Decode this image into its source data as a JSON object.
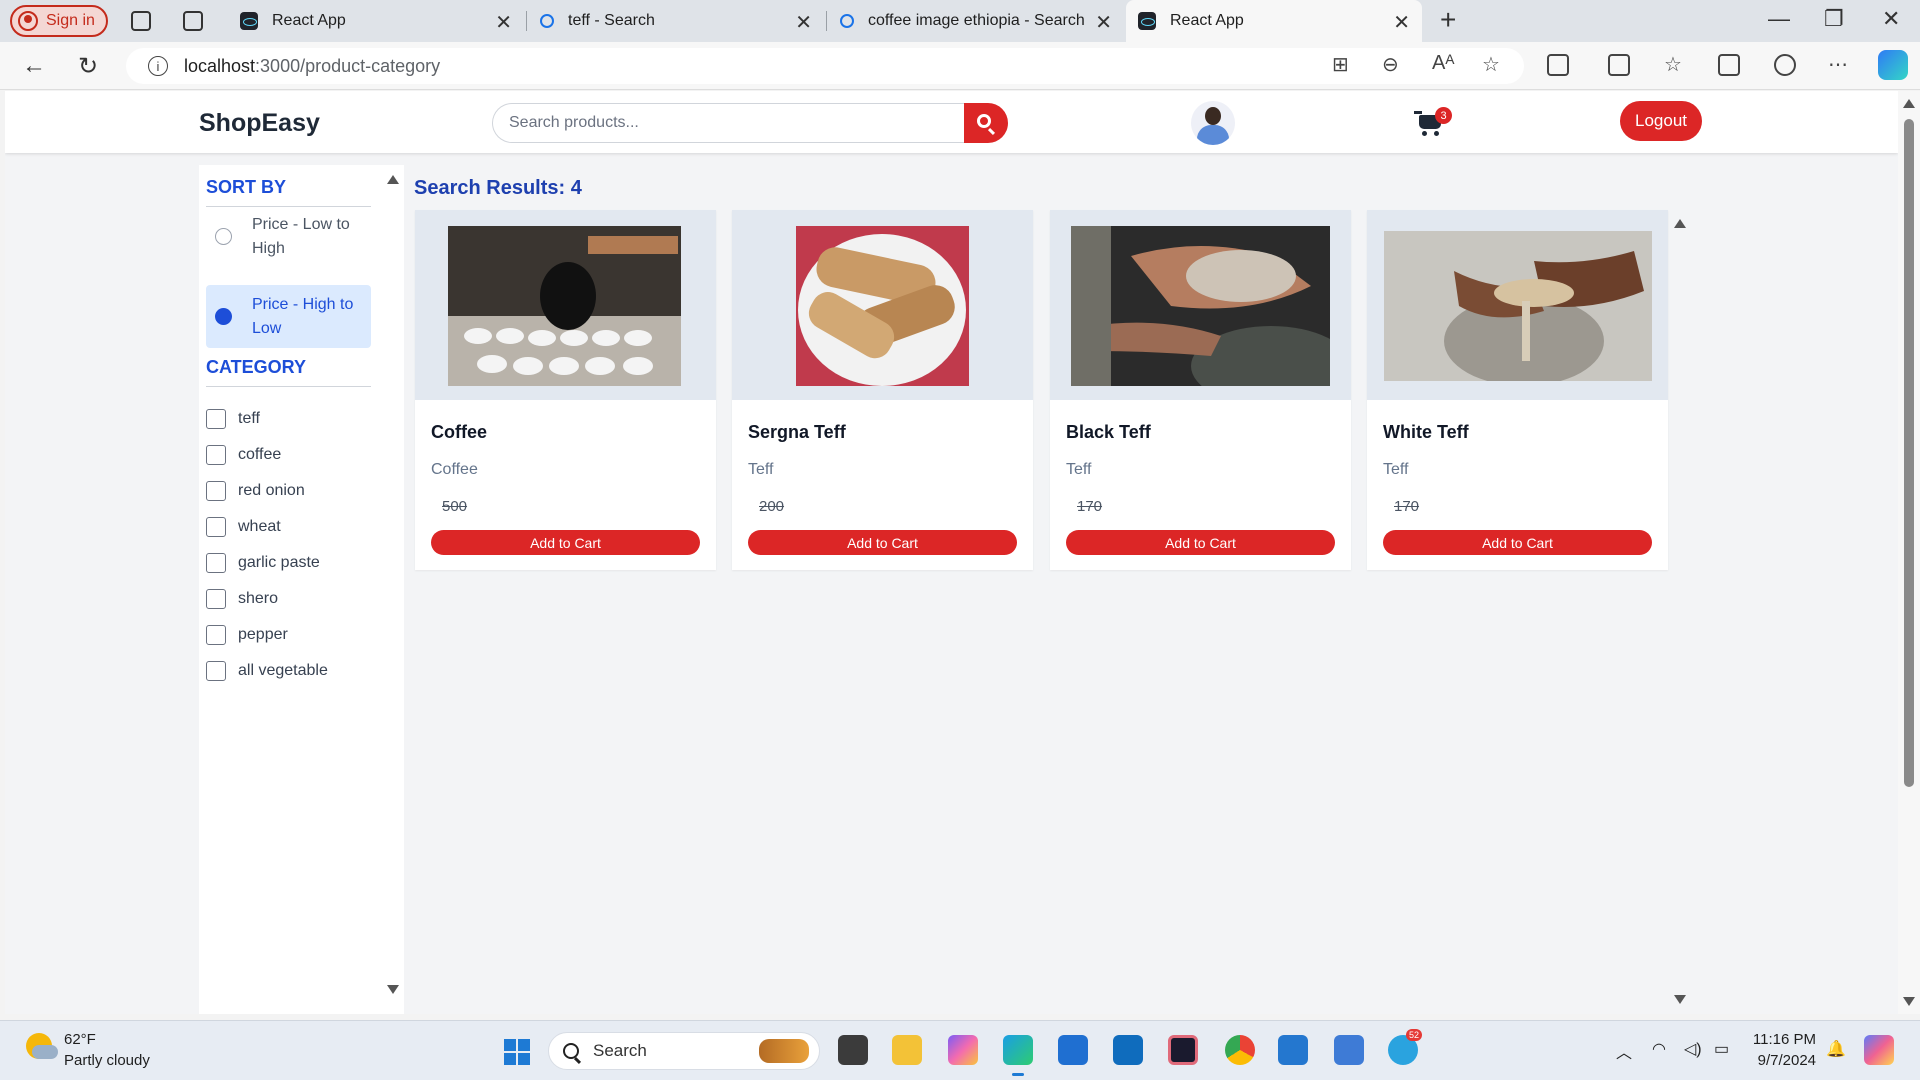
{
  "browser": {
    "sign_in": "Sign in",
    "tabs": [
      {
        "title": "React App",
        "favicon": "react-icon"
      },
      {
        "title": "teff - Search",
        "favicon": "search-icon"
      },
      {
        "title": "coffee image ethiopia - Search Im",
        "favicon": "search-icon"
      },
      {
        "title": "React App",
        "favicon": "react-icon",
        "active": true
      }
    ],
    "url_host": "localhost",
    "url_path": ":3000/product-category"
  },
  "app": {
    "brand": "ShopEasy",
    "search_placeholder": "Search products...",
    "cart_count": "3",
    "logout_label": "Logout",
    "accent_color": "#dc2626",
    "heading_color": "#1d4ed8"
  },
  "sidebar": {
    "sort_title": "SORT BY",
    "sort_options": [
      {
        "label": "Price - Low to High",
        "selected": false
      },
      {
        "label": "Price - High to Low",
        "selected": true
      }
    ],
    "category_title": "CATEGORY",
    "categories": [
      "teff",
      "coffee",
      "red onion",
      "wheat",
      "garlic paste",
      "shero",
      "pepper",
      "all vegetable"
    ]
  },
  "results": {
    "title": "Search Results: 4",
    "products": [
      {
        "name": "Coffee",
        "category": "Coffee",
        "price": "500",
        "button": "Add to Cart"
      },
      {
        "name": "Sergna Teff",
        "category": "Teff",
        "price": "200",
        "button": "Add to Cart"
      },
      {
        "name": "Black Teff",
        "category": "Teff",
        "price": "170",
        "button": "Add to Cart"
      },
      {
        "name": "White Teff",
        "category": "Teff",
        "price": "170",
        "button": "Add to Cart"
      }
    ]
  },
  "taskbar": {
    "temperature": "62°F",
    "condition": "Partly cloudy",
    "search_label": "Search",
    "time": "11:16 PM",
    "date": "9/7/2024",
    "telegram_badge": "52"
  }
}
